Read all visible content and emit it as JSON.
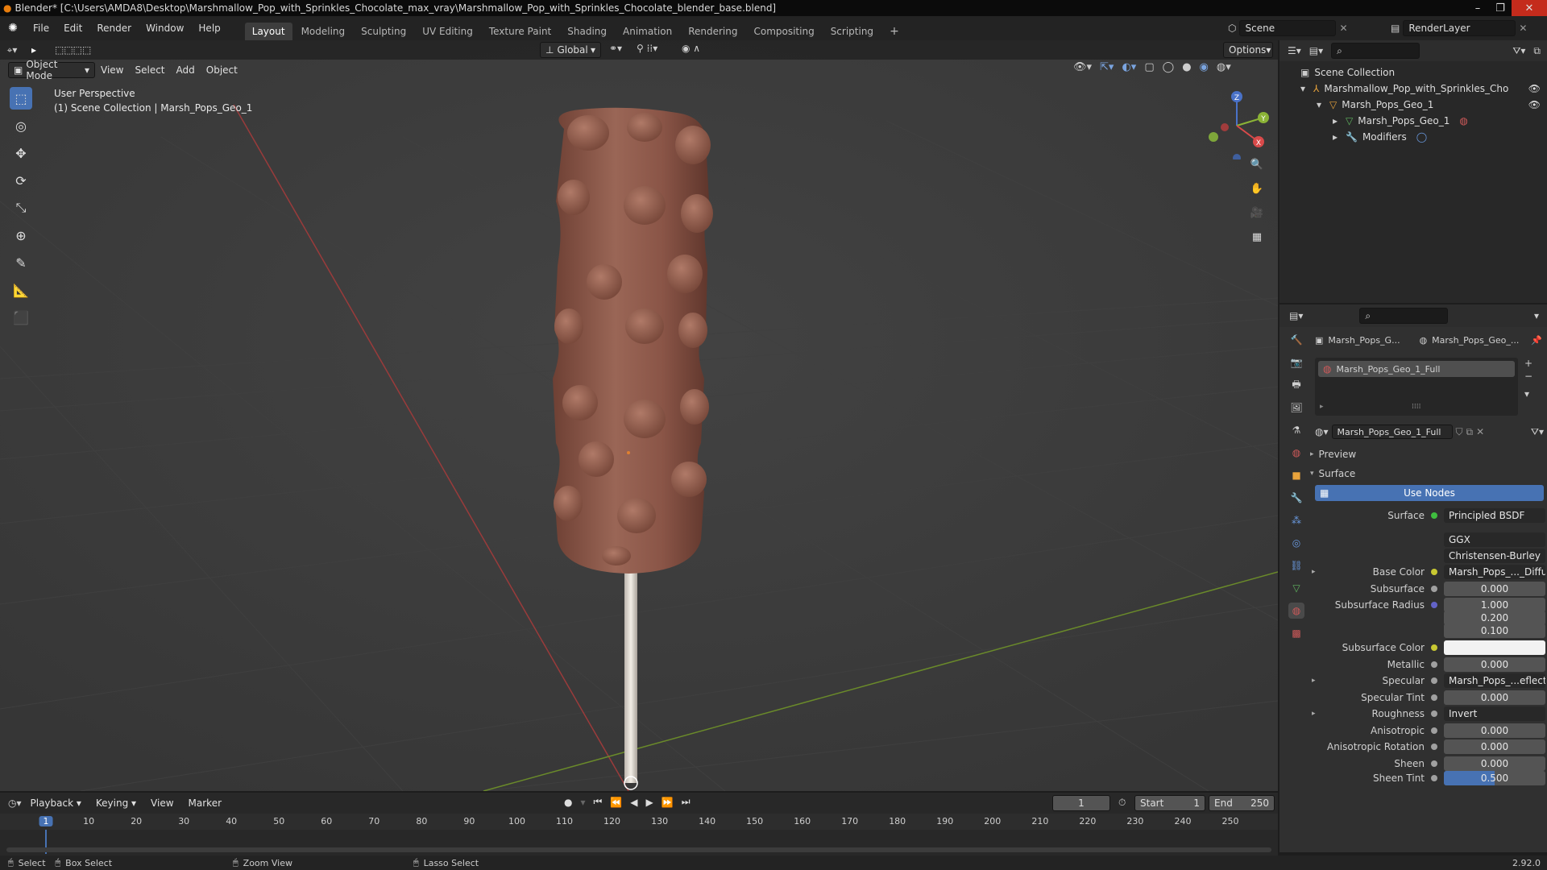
{
  "title": "Blender* [C:\\Users\\AMDA8\\Desktop\\Marshmallow_Pop_with_Sprinkles_Chocolate_max_vray\\Marshmallow_Pop_with_Sprinkles_Chocolate_blender_base.blend]",
  "menu": [
    "File",
    "Edit",
    "Render",
    "Window",
    "Help"
  ],
  "workspaces": [
    "Layout",
    "Modeling",
    "Sculpting",
    "UV Editing",
    "Texture Paint",
    "Shading",
    "Animation",
    "Rendering",
    "Compositing",
    "Scripting"
  ],
  "active_workspace": "Layout",
  "scene": "Scene",
  "render_layer": "RenderLayer",
  "viewport": {
    "mode": "Object Mode",
    "menus": [
      "View",
      "Select",
      "Add",
      "Object"
    ],
    "orientation": "Global",
    "options": "Options",
    "overlay_line1": "User Perspective",
    "overlay_line2": "(1) Scene Collection | Marsh_Pops_Geo_1",
    "gizmo": {
      "x": "X",
      "y": "Y",
      "z": "Z"
    }
  },
  "outliner": {
    "root": "Scene Collection",
    "items": [
      {
        "label": "Marshmallow_Pop_with_Sprinkles_Chocolate"
      },
      {
        "label": "Marsh_Pops_Geo_1"
      },
      {
        "label": "Marsh_Pops_Geo_1"
      },
      {
        "label": "Modifiers"
      }
    ]
  },
  "properties": {
    "breadcrumb_obj": "Marsh_Pops_G...",
    "breadcrumb_mat": "Marsh_Pops_Geo_...",
    "slot": "Marsh_Pops_Geo_1_Full",
    "material": "Marsh_Pops_Geo_1_Full",
    "preview": "Preview",
    "surface_section": "Surface",
    "use_nodes": "Use Nodes",
    "rows": [
      {
        "label": "Surface",
        "value": "Principled BSDF",
        "kind": "txt",
        "color": "#3fbd3f"
      },
      {
        "label": "",
        "value": "GGX",
        "kind": "txt",
        "color": ""
      },
      {
        "label": "",
        "value": "Christensen-Burley",
        "kind": "txt",
        "color": ""
      },
      {
        "label": "Base Color",
        "value": "Marsh_Pops_..._Diffuse.png",
        "kind": "txt",
        "color": "#c8c832"
      },
      {
        "label": "Subsurface",
        "value": "0.000",
        "kind": "val",
        "color": "#a0a0a0"
      },
      {
        "label": "Subsurface Radius",
        "value": "1.000",
        "kind": "val",
        "color": "#6363c7"
      },
      {
        "label": "",
        "value": "0.200",
        "kind": "val",
        "color": ""
      },
      {
        "label": "",
        "value": "0.100",
        "kind": "val",
        "color": ""
      },
      {
        "label": "Subsurface Color",
        "value": "",
        "kind": "color",
        "color": "#c8c832"
      },
      {
        "label": "Metallic",
        "value": "0.000",
        "kind": "val",
        "color": "#a0a0a0"
      },
      {
        "label": "Specular",
        "value": "Marsh_Pops_...eflection.png",
        "kind": "txt",
        "color": "#a0a0a0"
      },
      {
        "label": "Specular Tint",
        "value": "0.000",
        "kind": "val",
        "color": "#a0a0a0"
      },
      {
        "label": "Roughness",
        "value": "Invert",
        "kind": "txt",
        "color": "#a0a0a0"
      },
      {
        "label": "Anisotropic",
        "value": "0.000",
        "kind": "val",
        "color": "#a0a0a0"
      },
      {
        "label": "Anisotropic Rotation",
        "value": "0.000",
        "kind": "val",
        "color": "#a0a0a0"
      },
      {
        "label": "Sheen",
        "value": "0.000",
        "kind": "val",
        "color": "#a0a0a0"
      },
      {
        "label": "Sheen Tint",
        "value": "0.500",
        "kind": "bar",
        "color": "#a0a0a0"
      }
    ]
  },
  "timeline": {
    "menus": [
      "Playback",
      "Keying",
      "View",
      "Marker"
    ],
    "current_frame": "1",
    "start_label": "Start",
    "start": "1",
    "end_label": "End",
    "end": "250",
    "ticks": [
      "1",
      "10",
      "20",
      "30",
      "40",
      "50",
      "60",
      "70",
      "80",
      "90",
      "100",
      "110",
      "120",
      "130",
      "140",
      "150",
      "160",
      "170",
      "180",
      "190",
      "200",
      "210",
      "220",
      "230",
      "240",
      "250"
    ]
  },
  "status": {
    "select": "Select",
    "box_select": "Box Select",
    "zoom_view": "Zoom View",
    "lasso_select": "Lasso Select",
    "version": "2.92.0"
  }
}
